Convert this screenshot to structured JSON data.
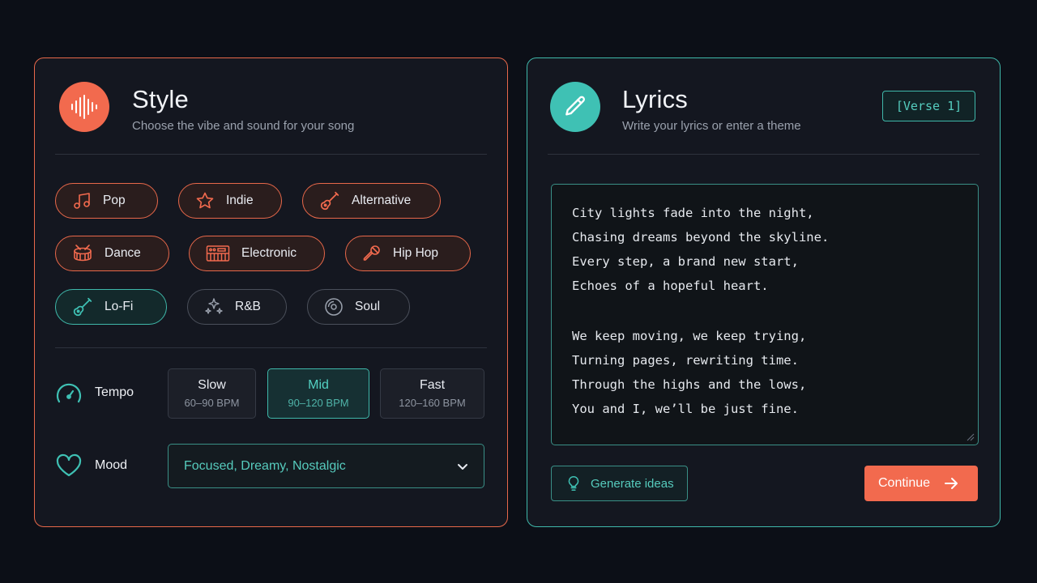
{
  "style_panel": {
    "title": "Style",
    "subtitle": "Choose the vibe and sound for your song",
    "genres": [
      {
        "label": "Pop",
        "icon": "music-note-icon",
        "state": "selected"
      },
      {
        "label": "Indie",
        "icon": "star-icon",
        "state": "selected"
      },
      {
        "label": "Alternative",
        "icon": "electric-guitar-icon",
        "state": "selected"
      },
      {
        "label": "Dance",
        "icon": "drum-icon",
        "state": "selected"
      },
      {
        "label": "Electronic",
        "icon": "synth-keyboard-icon",
        "state": "selected"
      },
      {
        "label": "Hip Hop",
        "icon": "microphone-icon",
        "state": "selected"
      },
      {
        "label": "Lo-Fi",
        "icon": "acoustic-guitar-icon",
        "state": "highlighted"
      },
      {
        "label": "R&B",
        "icon": "sparkles-icon",
        "state": "unselected"
      },
      {
        "label": "Soul",
        "icon": "vinyl-record-icon",
        "state": "unselected"
      }
    ],
    "tempo": {
      "label": "Tempo",
      "icon": "speedometer-icon",
      "options": [
        {
          "name": "Slow",
          "bpm": "60–90 BPM",
          "active": false
        },
        {
          "name": "Mid",
          "bpm": "90–120 BPM",
          "active": true
        },
        {
          "name": "Fast",
          "bpm": "120–160 BPM",
          "active": false
        }
      ]
    },
    "mood": {
      "label": "Mood",
      "icon": "heart-icon",
      "value": "Focused, Dreamy, Nostalgic"
    }
  },
  "lyrics_panel": {
    "title": "Lyrics",
    "subtitle": "Write your lyrics or enter a theme",
    "tag": "[Verse 1]",
    "stanzas": [
      [
        "City lights fade into the night,",
        "Chasing dreams beyond the skyline.",
        "Every step, a brand new start,",
        "Echoes of a hopeful heart."
      ],
      [
        "We keep moving, we keep trying,",
        "Turning pages, rewriting time.",
        "Through the highs and the lows,",
        "You and I, we’ll be just fine."
      ]
    ],
    "generate_label": "Generate ideas",
    "continue_label": "Continue"
  },
  "colors": {
    "background": "#0c0f17",
    "accent_orange": "#f26a4e",
    "accent_teal": "#3fc1b4"
  }
}
